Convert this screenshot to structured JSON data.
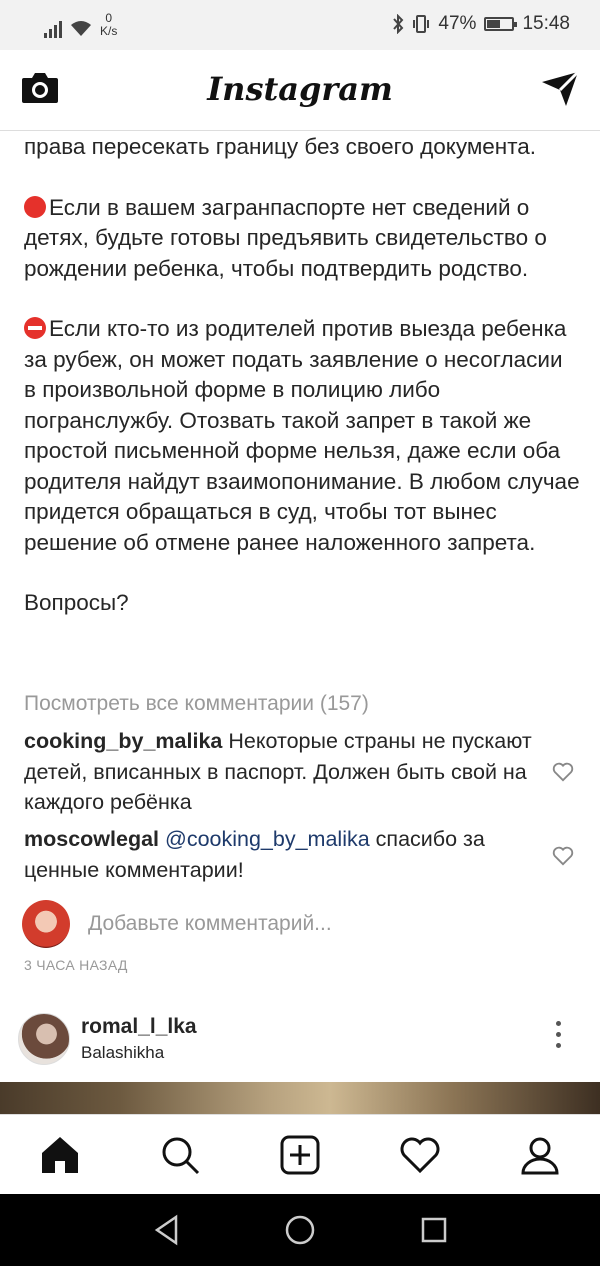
{
  "status_bar": {
    "net_speed": "0",
    "net_unit": "K/s",
    "battery_percent": "47%",
    "battery_level": 0.47,
    "time": "15:48"
  },
  "header": {
    "logo": "Instagram",
    "camera_icon": "camera-icon",
    "direct_icon": "paper-plane-icon"
  },
  "post": {
    "lines": {
      "p1": "права пересекать границу без своего документа.",
      "p2": "Если в вашем загранпаспорте нет сведений о детях, будьте готовы предъявить свидетельство о рождении ребенка, чтобы подтвердить родство.",
      "p3": "Если кто-то из родителей против выезда ребенка за рубеж, он может подать заявление о несогласии в произвольной форме в полицию либо погранслужбу. Отозвать такой запрет в такой же простой письменной форме нельзя, даже если оба родителя найдут взаимопонимание. В любом случае придется обращаться в суд, чтобы тот вынес решение об отмене ранее наложенного запрета.",
      "p4": "Вопросы?"
    },
    "view_all_comments": "Посмотреть все комментарии (157)",
    "comments": [
      {
        "user": "cooking_by_malika",
        "text": "Некоторые страны не пускают детей, вписанных в паспорт. Должен быть свой на каждого ребёнка"
      },
      {
        "user": "moscowlegal",
        "mention": "@cooking_by_malika",
        "text": "спасибо за ценные комментарии!"
      }
    ],
    "add_comment_placeholder": "Добавьте комментарий...",
    "time_ago": "3 ЧАСА НАЗАД"
  },
  "next_post": {
    "username": "romal_l_lka",
    "location": "Balashikha"
  },
  "colors": {
    "mention": "#1e3a6b",
    "muted": "#999999",
    "emoji_red": "#e5312b"
  }
}
